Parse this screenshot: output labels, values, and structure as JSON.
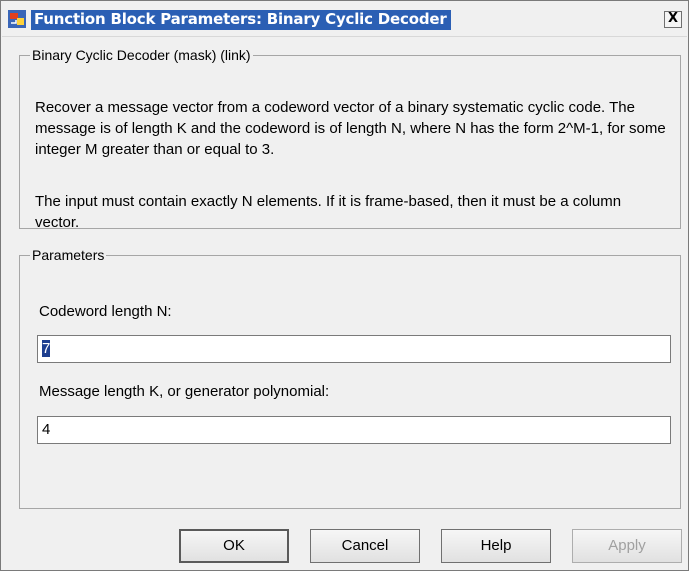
{
  "window": {
    "title": "Function Block Parameters: Binary Cyclic Decoder",
    "close_label": "X"
  },
  "description": {
    "group_label": "Binary Cyclic Decoder (mask) (link)",
    "paragraph1": "Recover a message vector from a codeword vector of a binary systematic cyclic code.  The message is of length K and the codeword is of length N, where N has the form 2^M-1, for some integer M greater than or equal to 3.",
    "paragraph2": "The input must contain exactly N elements.  If it is frame-based, then it must be a column vector."
  },
  "parameters": {
    "group_label": "Parameters",
    "codeword_length": {
      "label": "Codeword length N:",
      "value": "7"
    },
    "message_length": {
      "label": "Message length K, or generator polynomial:",
      "value": "4"
    }
  },
  "buttons": {
    "ok": "OK",
    "cancel": "Cancel",
    "help": "Help",
    "apply": "Apply"
  },
  "colors": {
    "title_highlight": "#2b5fb4",
    "selection": "#1e3f8f",
    "dialog_background": "#f0f0f0",
    "disabled_text": "#a0a0a0"
  }
}
